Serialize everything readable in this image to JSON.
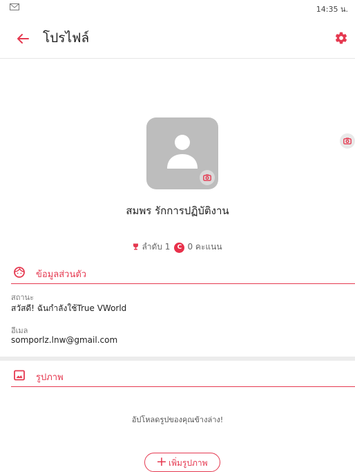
{
  "status_bar": {
    "time": "14:35 น.",
    "mail_icon": "mail-icon"
  },
  "app_bar": {
    "title": "โปรไฟล์",
    "back_icon": "arrow-back-icon",
    "settings_icon": "gear-icon"
  },
  "profile": {
    "name": "สมพร รักการปฏิบัติงาน",
    "rank_label": "ลำดับ",
    "rank_value": "1",
    "coin_letter": "C",
    "points_value": "0",
    "points_label": "คะแนน"
  },
  "personal_section": {
    "title": "ข้อมูลส่วนตัว",
    "icon": "face-icon",
    "status_label": "สถานะ",
    "status_value": "สวัสดี! ฉันกำลังใช้True VWorld",
    "email_label": "อีเมล",
    "email_value": "somporlz.lnw@gmail.com"
  },
  "photos_section": {
    "title": "รูปภาพ",
    "icon": "image-icon",
    "upload_hint": "อัปโหลดรูปของคุณข้างล่าง!",
    "add_button_label": "เพิ่มรูปภาพ"
  },
  "colors": {
    "accent": "#e53950",
    "avatar_bg": "#bdbdbd"
  }
}
